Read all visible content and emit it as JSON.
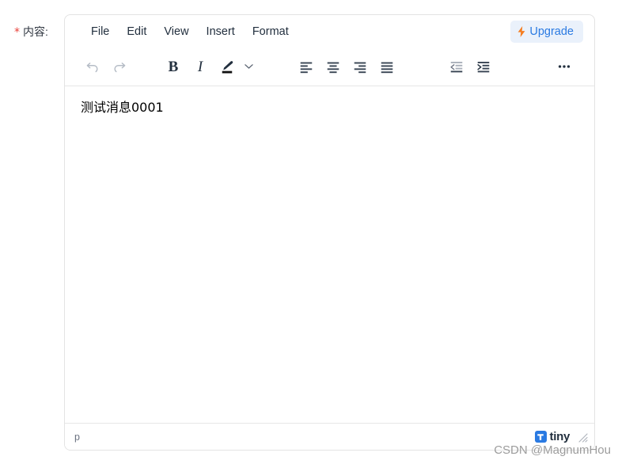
{
  "form": {
    "required_marker": "*",
    "label": "内容:"
  },
  "editor": {
    "menubar": {
      "items": [
        {
          "label": "File",
          "name": "menu-file"
        },
        {
          "label": "Edit",
          "name": "menu-edit"
        },
        {
          "label": "View",
          "name": "menu-view"
        },
        {
          "label": "Insert",
          "name": "menu-insert"
        },
        {
          "label": "Format",
          "name": "menu-format"
        }
      ],
      "upgrade": {
        "label": "Upgrade",
        "icon": "lightning-bolt-icon",
        "text_color": "#2a7ae2",
        "background": "#eaf1fb",
        "icon_color": "#f57c1f"
      }
    },
    "toolbar": {
      "buttons": [
        {
          "name": "undo-button",
          "icon": "undo-icon",
          "title": "Undo",
          "state": "disabled"
        },
        {
          "name": "redo-button",
          "icon": "redo-icon",
          "title": "Redo",
          "state": "disabled"
        },
        {
          "name": "bold-button",
          "icon": "bold-icon",
          "title": "Bold",
          "glyph": "B",
          "state": "enabled"
        },
        {
          "name": "italic-button",
          "icon": "italic-icon",
          "title": "Italic",
          "glyph": "I",
          "state": "enabled"
        },
        {
          "name": "text-color-button",
          "icon": "pen-color-icon",
          "title": "Text color",
          "state": "enabled"
        },
        {
          "name": "text-color-chevron",
          "icon": "chevron-down-icon",
          "title": "Text color options",
          "state": "enabled"
        },
        {
          "name": "align-left-button",
          "icon": "align-left-icon",
          "title": "Align left",
          "state": "enabled"
        },
        {
          "name": "align-center-button",
          "icon": "align-center-icon",
          "title": "Align center",
          "state": "enabled"
        },
        {
          "name": "align-right-button",
          "icon": "align-right-icon",
          "title": "Align right",
          "state": "enabled"
        },
        {
          "name": "align-justify-button",
          "icon": "align-justify-icon",
          "title": "Justify",
          "state": "enabled"
        },
        {
          "name": "outdent-button",
          "icon": "outdent-icon",
          "title": "Decrease indent",
          "state": "disabled"
        },
        {
          "name": "indent-button",
          "icon": "indent-icon",
          "title": "Increase indent",
          "state": "enabled"
        },
        {
          "name": "more-button",
          "icon": "more-horizontal-icon",
          "title": "More...",
          "state": "enabled"
        }
      ]
    },
    "content": {
      "paragraph": "测试消息0001"
    },
    "statusbar": {
      "element_path": "p",
      "brand": "tiny",
      "brand_icon": "tiny-logo-icon",
      "resize_handle": "resize-handle-icon"
    }
  },
  "watermark": {
    "text": "CSDN @MagnumHou"
  },
  "colors": {
    "accent_blue": "#2a7ae2",
    "required_red": "#e8413a",
    "icon_dark": "#222f3e",
    "icon_disabled": "#b5bcc6",
    "border": "#e3e3e3"
  }
}
